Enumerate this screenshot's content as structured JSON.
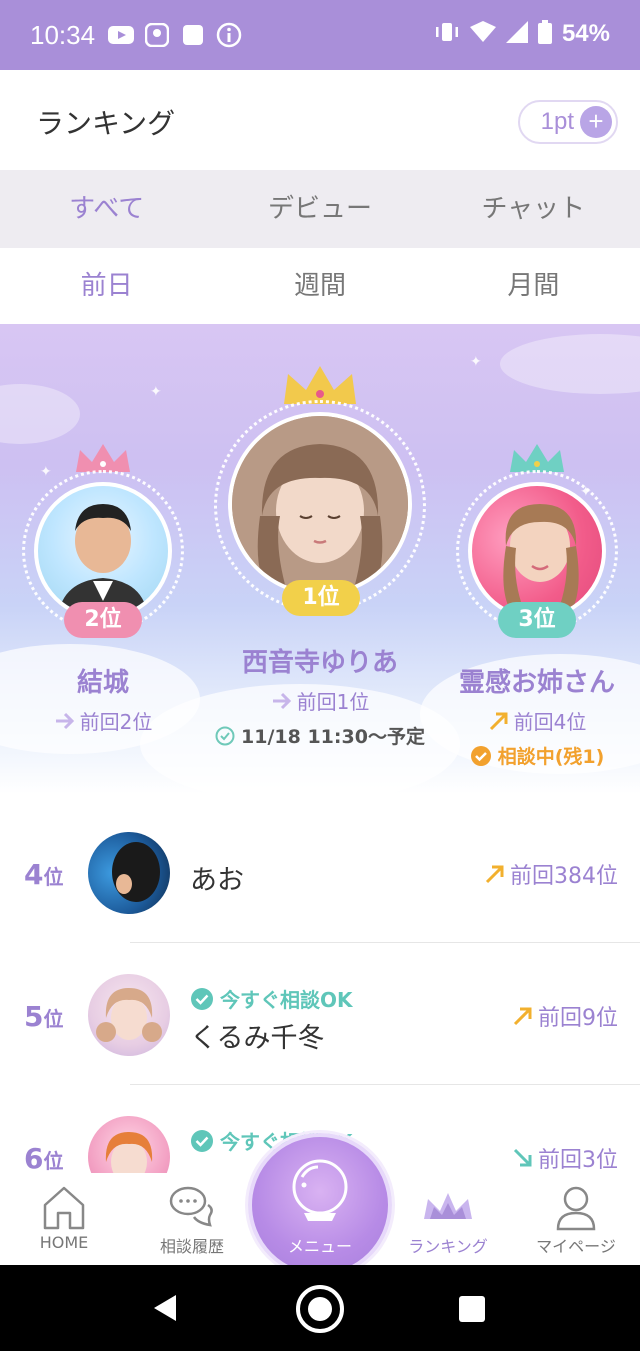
{
  "status_bar": {
    "time": "10:34",
    "battery": "54%"
  },
  "header": {
    "title": "ランキング",
    "points": "1pt"
  },
  "category_tabs": [
    {
      "label": "すべて",
      "active": true
    },
    {
      "label": "デビュー",
      "active": false
    },
    {
      "label": "チャット",
      "active": false
    }
  ],
  "period_tabs": [
    {
      "label": "前日",
      "active": true
    },
    {
      "label": "週間",
      "active": false
    },
    {
      "label": "月間",
      "active": false
    }
  ],
  "podium": {
    "first": {
      "rank": "1位",
      "name": "西音寺ゆりあ",
      "prev": "前回1位",
      "schedule": "11/18 11:30〜予定"
    },
    "second": {
      "rank": "2位",
      "name": "結城",
      "prev": "前回2位"
    },
    "third": {
      "rank": "3位",
      "name": "霊感お姉さん",
      "prev": "前回4位",
      "status": "相談中(残1)"
    }
  },
  "list": [
    {
      "rank": "4",
      "unit": "位",
      "name": "あお",
      "status": "",
      "prev": "前回384位",
      "trend": "up"
    },
    {
      "rank": "5",
      "unit": "位",
      "name": "くるみ千冬",
      "status": "今すぐ相談OK",
      "prev": "前回9位",
      "trend": "up"
    },
    {
      "rank": "6",
      "unit": "位",
      "name": "",
      "status": "今すぐ相談OK",
      "prev": "前回3位",
      "trend": "down"
    }
  ],
  "bottom_nav": {
    "home": "HOME",
    "history": "相談履歴",
    "menu": "メニュー",
    "ranking": "ランキング",
    "mypage": "マイページ"
  },
  "colors": {
    "accent": "#9b82d1",
    "statusbar": "#a98fd9",
    "gold": "#f2c94c",
    "pink": "#f08fb0",
    "teal": "#6fd0c3",
    "orange": "#f2a12e"
  }
}
